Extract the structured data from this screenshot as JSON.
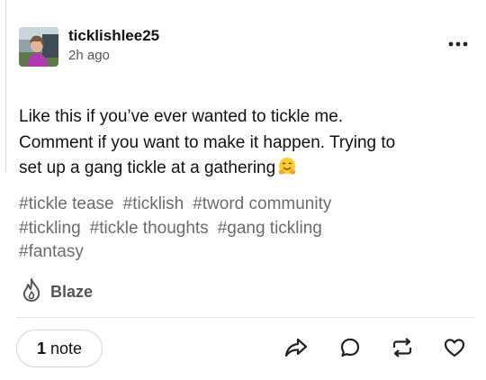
{
  "post": {
    "username": "ticklishlee25",
    "timestamp": "2h ago",
    "text_lines": [
      "Like this if you’ve ever wanted to tickle me.",
      "Comment if you want to make it happen. Trying to",
      "set up a gang tickle at a gathering"
    ],
    "emoji": "hugging-face-emoji",
    "tags": [
      "#tickle tease",
      "#ticklish",
      "#tword community",
      "#tickling",
      "#tickle thoughts",
      "#gang tickling",
      "#fantasy"
    ]
  },
  "blaze": {
    "label": "Blaze",
    "icon": "flame-icon"
  },
  "footer": {
    "notes_count": "1",
    "notes_label": "note",
    "actions": [
      "share-icon",
      "reply-icon",
      "reblog-icon",
      "like-icon"
    ]
  },
  "menu": {
    "icon": "more-options-icon"
  },
  "colors": {
    "text": "#111111",
    "muted": "#555555",
    "tag": "#6b6b6b",
    "border": "#d4d4d4"
  }
}
